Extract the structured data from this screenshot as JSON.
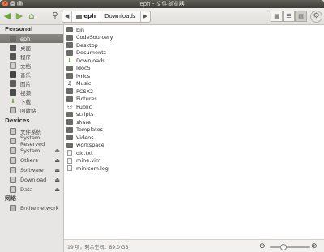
{
  "window": {
    "title": "eph - 文件浏览器",
    "close": "×",
    "minimize": "–",
    "maximize": "□"
  },
  "toolbar": {
    "back": "◀",
    "forward": "▶",
    "home": "⌂",
    "search": "⚲"
  },
  "path": {
    "arrow": "◀",
    "segments": [
      "eph",
      "Downloads"
    ],
    "more": "▶"
  },
  "view_buttons": [
    "▦",
    "☰",
    "▤"
  ],
  "settings_icon": "⚙",
  "sidebar": {
    "personal_header": "Personal",
    "personal": [
      {
        "label": "eph",
        "icon": "home-folder-icon"
      },
      {
        "label": "桌面",
        "icon": "desktop-icon"
      },
      {
        "label": "程序",
        "icon": "programs-icon"
      },
      {
        "label": "文档",
        "icon": "documents-icon"
      },
      {
        "label": "音乐",
        "icon": "music-icon"
      },
      {
        "label": "图片",
        "icon": "pictures-icon"
      },
      {
        "label": "视频",
        "icon": "videos-icon"
      },
      {
        "label": "下载",
        "icon": "downloads-icon"
      },
      {
        "label": "回收站",
        "icon": "trash-icon"
      }
    ],
    "devices_header": "Devices",
    "devices": [
      {
        "label": "文件系统",
        "eject": false
      },
      {
        "label": "System Reserved",
        "eject": false
      },
      {
        "label": "System",
        "eject": true
      },
      {
        "label": "Others",
        "eject": true
      },
      {
        "label": "Software",
        "eject": true
      },
      {
        "label": "Download",
        "eject": true
      },
      {
        "label": "Data",
        "eject": true
      }
    ],
    "network_header": "网络",
    "network": [
      {
        "label": "Entire network"
      }
    ]
  },
  "files": [
    {
      "name": "bin",
      "type": "folder"
    },
    {
      "name": "CodeSourcery",
      "type": "folder"
    },
    {
      "name": "Desktop",
      "type": "folder"
    },
    {
      "name": "Documents",
      "type": "folder"
    },
    {
      "name": "Downloads",
      "type": "downloads"
    },
    {
      "name": "Idoc5",
      "type": "folder"
    },
    {
      "name": "lyrics",
      "type": "folder"
    },
    {
      "name": "Music",
      "type": "music"
    },
    {
      "name": "PCSX2",
      "type": "folder"
    },
    {
      "name": "Pictures",
      "type": "folder"
    },
    {
      "name": "Public",
      "type": "public"
    },
    {
      "name": "scripts",
      "type": "folder"
    },
    {
      "name": "share",
      "type": "folder"
    },
    {
      "name": "Templates",
      "type": "folder"
    },
    {
      "name": "Videos",
      "type": "folder"
    },
    {
      "name": "workspace",
      "type": "folder"
    },
    {
      "name": "dic.txt",
      "type": "file"
    },
    {
      "name": "mine.vim",
      "type": "file"
    },
    {
      "name": "minicom.log",
      "type": "file"
    }
  ],
  "status": {
    "text": "19 项，剩余空间：89.0 GB",
    "zoom_out": "⊖",
    "zoom_in": "⊕",
    "zoom_level": 0.33
  },
  "eject_glyph": "⏏"
}
